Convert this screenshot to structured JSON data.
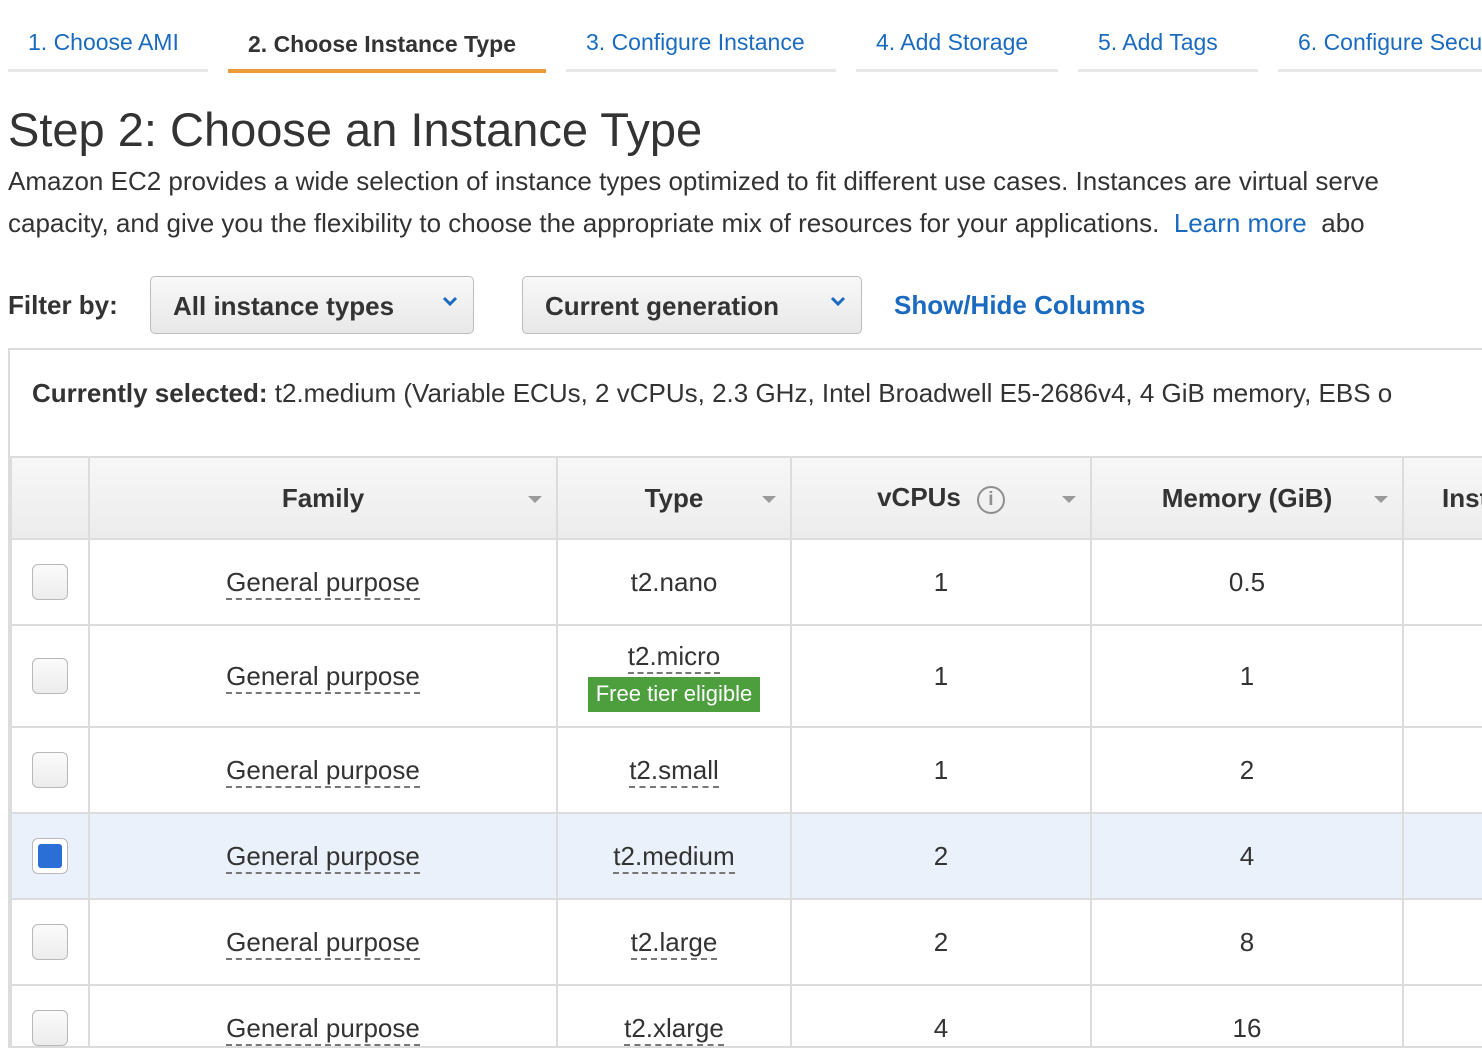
{
  "wizard": {
    "tabs": [
      {
        "label": "1. Choose AMI"
      },
      {
        "label": "2. Choose Instance Type"
      },
      {
        "label": "3. Configure Instance"
      },
      {
        "label": "4. Add Storage"
      },
      {
        "label": "5. Add Tags"
      },
      {
        "label": "6. Configure Secu"
      }
    ],
    "active_tab": "2. Choose Instance Type"
  },
  "page": {
    "title": "Step 2: Choose an Instance Type",
    "description_line1": "Amazon EC2 provides a wide selection of instance types optimized to fit different use cases. Instances are virtual serve",
    "description_line2": "capacity, and give you the flexibility to choose the appropriate mix of resources for your applications.",
    "learn_more": "Learn more",
    "description_tail": "abo"
  },
  "filter": {
    "label": "Filter by:",
    "instance_types": "All instance types",
    "generation": "Current generation",
    "show_hide": "Show/Hide Columns"
  },
  "selection": {
    "label": "Currently selected:",
    "value": "t2.medium (Variable ECUs, 2 vCPUs, 2.3 GHz, Intel Broadwell E5-2686v4, 4 GiB memory, EBS o"
  },
  "table": {
    "columns": [
      "Family",
      "Type",
      "vCPUs",
      "Memory (GiB)",
      "Inst"
    ],
    "rows": [
      {
        "family": "General purpose",
        "type": "t2.nano",
        "vcpus": "1",
        "memory": "0.5",
        "selected": false
      },
      {
        "family": "General purpose",
        "type": "t2.micro",
        "badge": "Free tier eligible",
        "vcpus": "1",
        "memory": "1",
        "selected": false
      },
      {
        "family": "General purpose",
        "type": "t2.small",
        "vcpus": "1",
        "memory": "2",
        "selected": false
      },
      {
        "family": "General purpose",
        "type": "t2.medium",
        "vcpus": "2",
        "memory": "4",
        "selected": true
      },
      {
        "family": "General purpose",
        "type": "t2.large",
        "vcpus": "2",
        "memory": "8",
        "selected": false
      },
      {
        "family": "General purpose",
        "type": "t2.xlarge",
        "vcpus": "4",
        "memory": "16",
        "selected": false
      }
    ]
  },
  "colors": {
    "link": "#1a6bbf",
    "active_tab_underline": "#ec9a37",
    "badge": "#4d9f3e",
    "selected_row": "#eaf1fb",
    "checkbox_checked": "#2a6ed6"
  }
}
